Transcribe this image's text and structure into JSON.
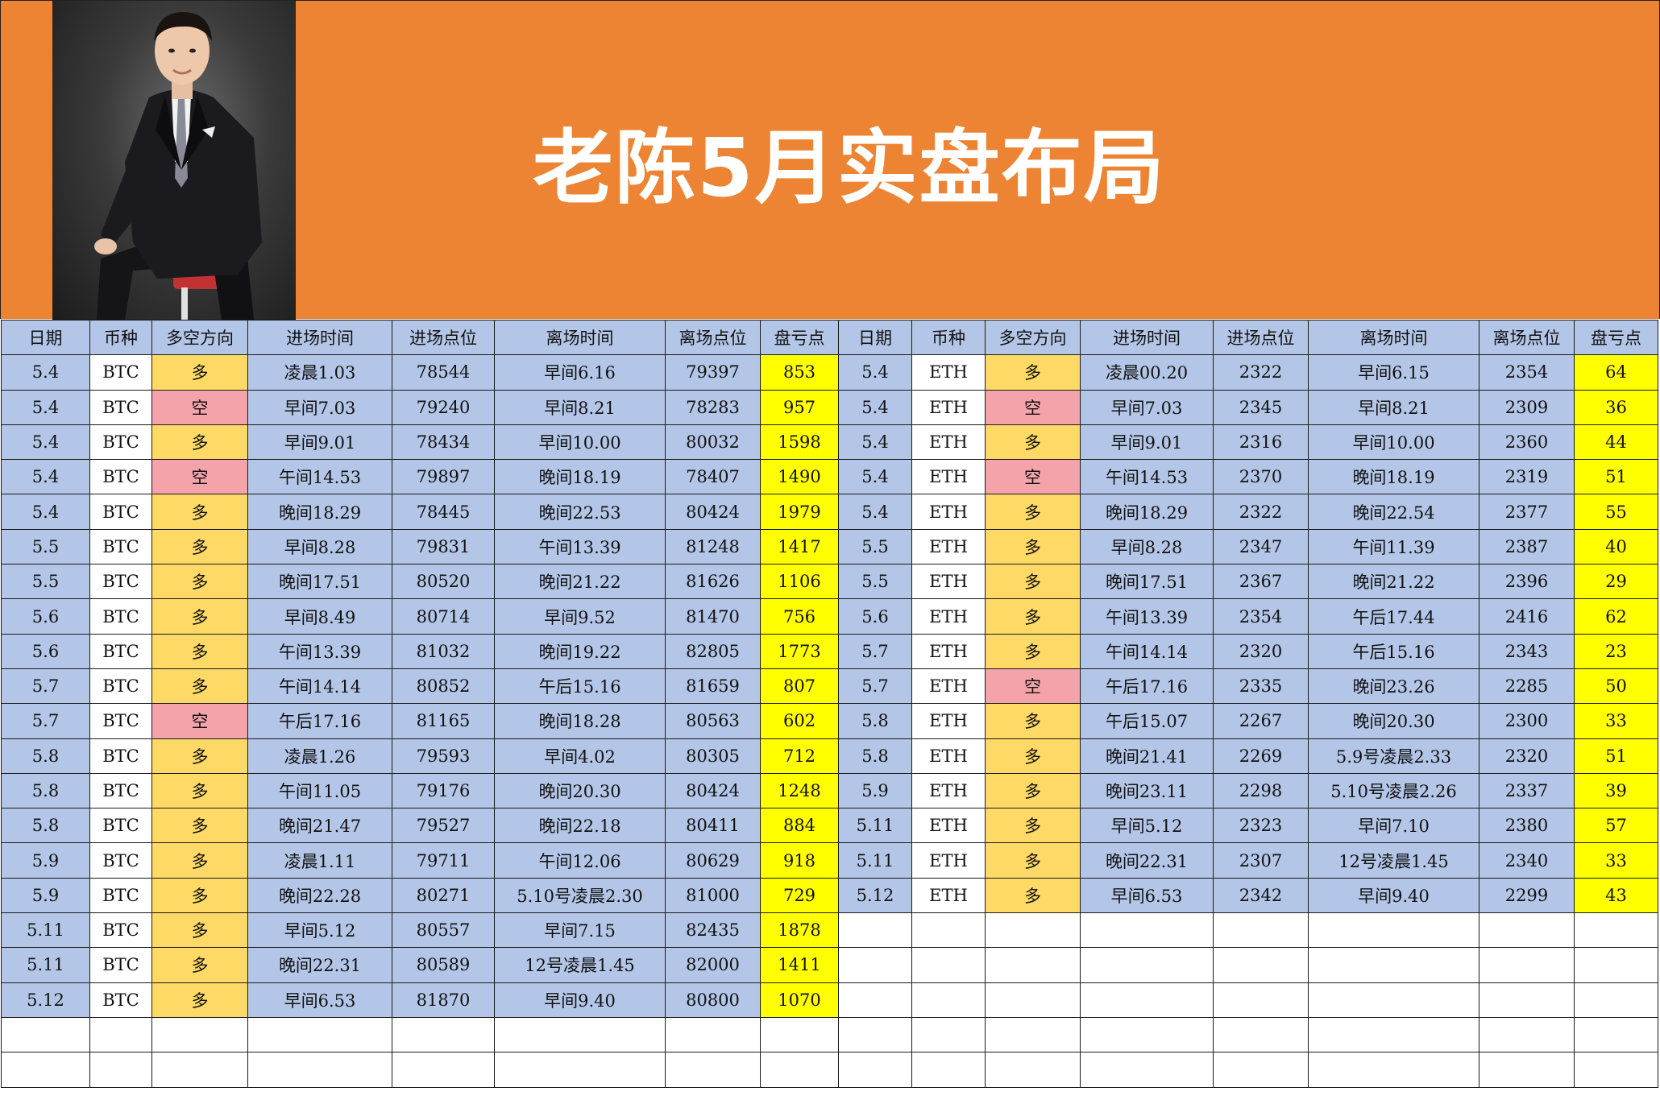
{
  "title": "老陈5月实盘布局",
  "headers": [
    "日期",
    "币种",
    "多空方向",
    "进场时间",
    "进场点位",
    "离场时间",
    "离场点位",
    "盘亏点",
    "日期",
    "币种",
    "多空方向",
    "进场时间",
    "进场点位",
    "离场时间",
    "离场点位",
    "盘亏点"
  ],
  "btc": [
    [
      "5.4",
      "BTC",
      "多",
      "凌晨1.03",
      "78544",
      "早间6.16",
      "79397",
      "853"
    ],
    [
      "5.4",
      "BTC",
      "空",
      "早间7.03",
      "79240",
      "早间8.21",
      "78283",
      "957"
    ],
    [
      "5.4",
      "BTC",
      "多",
      "早间9.01",
      "78434",
      "早间10.00",
      "80032",
      "1598"
    ],
    [
      "5.4",
      "BTC",
      "空",
      "午间14.53",
      "79897",
      "晚间18.19",
      "78407",
      "1490"
    ],
    [
      "5.4",
      "BTC",
      "多",
      "晚间18.29",
      "78445",
      "晚间22.53",
      "80424",
      "1979"
    ],
    [
      "5.5",
      "BTC",
      "多",
      "早间8.28",
      "79831",
      "午间13.39",
      "81248",
      "1417"
    ],
    [
      "5.5",
      "BTC",
      "多",
      "晚间17.51",
      "80520",
      "晚间21.22",
      "81626",
      "1106"
    ],
    [
      "5.6",
      "BTC",
      "多",
      "早间8.49",
      "80714",
      "早间9.52",
      "81470",
      "756"
    ],
    [
      "5.6",
      "BTC",
      "多",
      "午间13.39",
      "81032",
      "晚间19.22",
      "82805",
      "1773"
    ],
    [
      "5.7",
      "BTC",
      "多",
      "午间14.14",
      "80852",
      "午后15.16",
      "81659",
      "807"
    ],
    [
      "5.7",
      "BTC",
      "空",
      "午后17.16",
      "81165",
      "晚间18.28",
      "80563",
      "602"
    ],
    [
      "5.8",
      "BTC",
      "多",
      "凌晨1.26",
      "79593",
      "早间4.02",
      "80305",
      "712"
    ],
    [
      "5.8",
      "BTC",
      "多",
      "午间11.05",
      "79176",
      "晚间20.30",
      "80424",
      "1248"
    ],
    [
      "5.8",
      "BTC",
      "多",
      "晚间21.47",
      "79527",
      "晚间22.18",
      "80411",
      "884"
    ],
    [
      "5.9",
      "BTC",
      "多",
      "凌晨1.11",
      "79711",
      "午间12.06",
      "80629",
      "918"
    ],
    [
      "5.9",
      "BTC",
      "多",
      "晚间22.28",
      "80271",
      "5.10号凌晨2.30",
      "81000",
      "729"
    ],
    [
      "5.11",
      "BTC",
      "多",
      "早间5.12",
      "80557",
      "早间7.15",
      "82435",
      "1878"
    ],
    [
      "5.11",
      "BTC",
      "多",
      "晚间22.31",
      "80589",
      "12号凌晨1.45",
      "82000",
      "1411"
    ],
    [
      "5.12",
      "BTC",
      "多",
      "早间6.53",
      "81870",
      "早间9.40",
      "80800",
      "1070"
    ]
  ],
  "eth": [
    [
      "5.4",
      "ETH",
      "多",
      "凌晨00.20",
      "2322",
      "早间6.15",
      "2354",
      "64"
    ],
    [
      "5.4",
      "ETH",
      "空",
      "早间7.03",
      "2345",
      "早间8.21",
      "2309",
      "36"
    ],
    [
      "5.4",
      "ETH",
      "多",
      "早间9.01",
      "2316",
      "早间10.00",
      "2360",
      "44"
    ],
    [
      "5.4",
      "ETH",
      "空",
      "午间14.53",
      "2370",
      "晚间18.19",
      "2319",
      "51"
    ],
    [
      "5.4",
      "ETH",
      "多",
      "晚间18.29",
      "2322",
      "晚间22.54",
      "2377",
      "55"
    ],
    [
      "5.5",
      "ETH",
      "多",
      "早间8.28",
      "2347",
      "午间11.39",
      "2387",
      "40"
    ],
    [
      "5.5",
      "ETH",
      "多",
      "晚间17.51",
      "2367",
      "晚间21.22",
      "2396",
      "29"
    ],
    [
      "5.6",
      "ETH",
      "多",
      "午间13.39",
      "2354",
      "午后17.44",
      "2416",
      "62"
    ],
    [
      "5.7",
      "ETH",
      "多",
      "午间14.14",
      "2320",
      "午后15.16",
      "2343",
      "23"
    ],
    [
      "5.7",
      "ETH",
      "空",
      "午后17.16",
      "2335",
      "晚间23.26",
      "2285",
      "50"
    ],
    [
      "5.8",
      "ETH",
      "多",
      "午后15.07",
      "2267",
      "晚间20.30",
      "2300",
      "33"
    ],
    [
      "5.8",
      "ETH",
      "多",
      "晚间21.41",
      "2269",
      "5.9号凌晨2.33",
      "2320",
      "51"
    ],
    [
      "5.9",
      "ETH",
      "多",
      "晚间23.11",
      "2298",
      "5.10号凌晨2.26",
      "2337",
      "39"
    ],
    [
      "5.11",
      "ETH",
      "多",
      "早间5.12",
      "2323",
      "早间7.10",
      "2380",
      "57"
    ],
    [
      "5.11",
      "ETH",
      "多",
      "晚间22.31",
      "2307",
      "12号凌晨1.45",
      "2340",
      "33"
    ],
    [
      "5.12",
      "ETH",
      "多",
      "早间6.53",
      "2342",
      "早间9.40",
      "2299",
      "43"
    ]
  ],
  "colors": {
    "banner": "#ec8433",
    "cell_blue": "#b4c6e7",
    "long": "#ffd966",
    "short": "#f4a3ab",
    "profit": "#ffff00",
    "coin_text": "#cc0000"
  },
  "total_rows": 21
}
